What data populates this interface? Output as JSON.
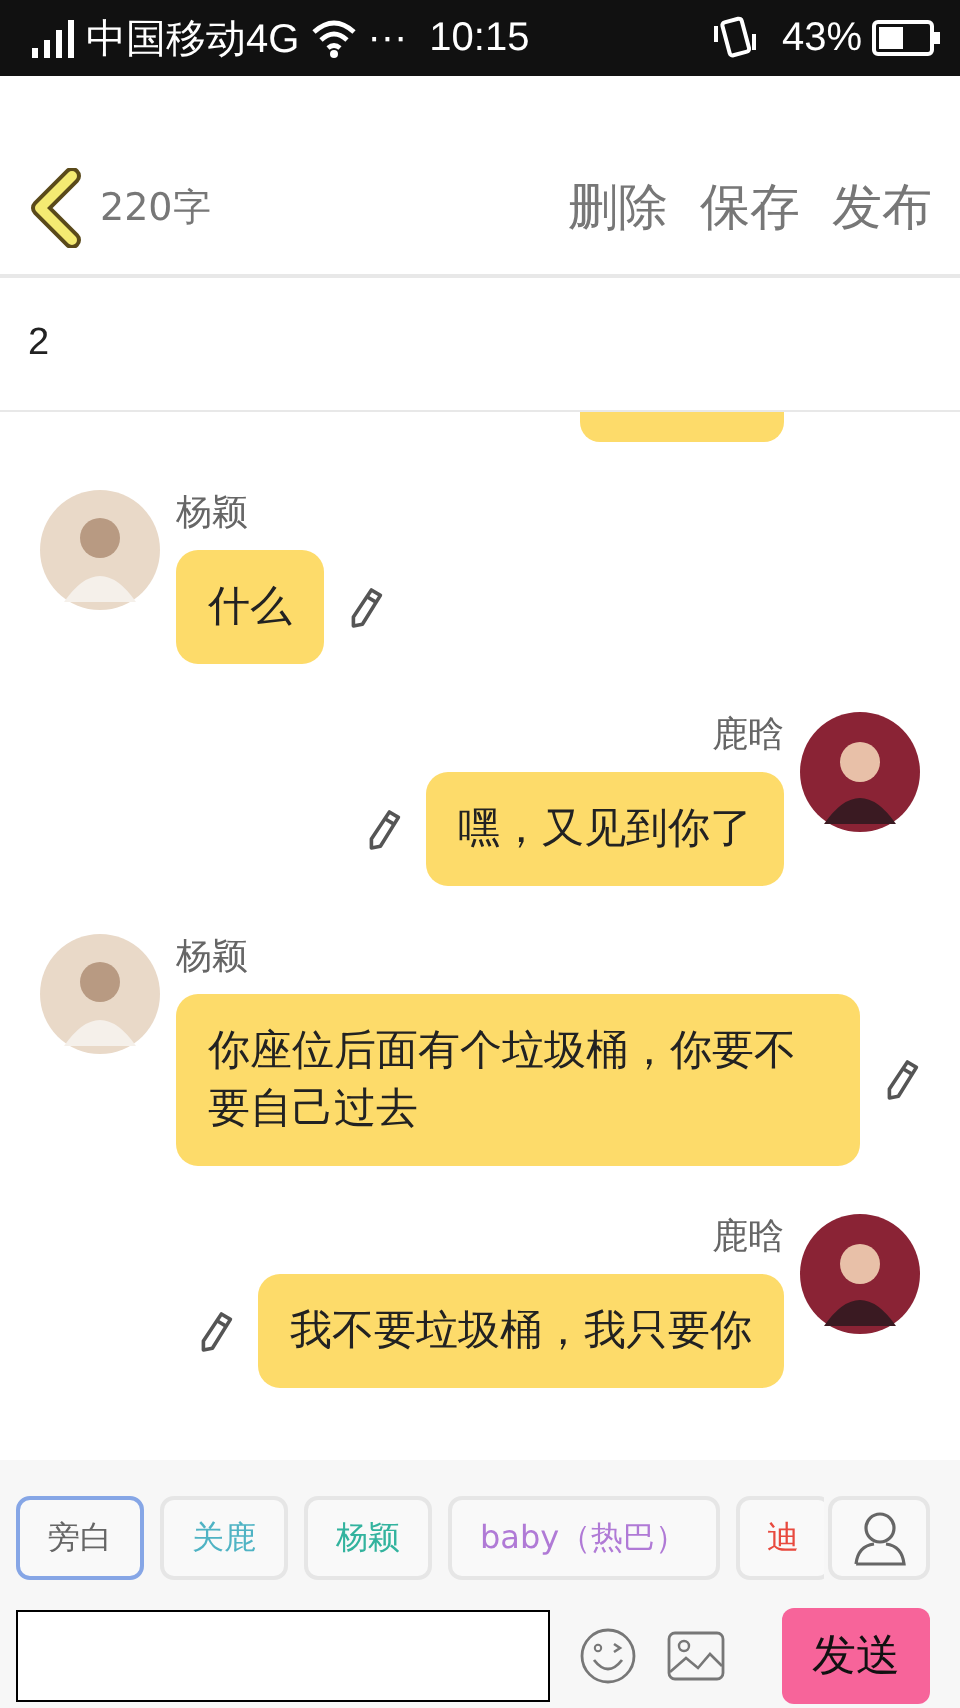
{
  "status_bar": {
    "carrier": "中国移动4G",
    "dots": "···",
    "time": "10:15",
    "battery_text": "43%"
  },
  "header": {
    "count": "220字",
    "actions": [
      "删除",
      "保存",
      "发布"
    ]
  },
  "title_field": {
    "value": "2"
  },
  "messages": [
    {
      "kind": "left",
      "name": "杨颖",
      "text": "什么"
    },
    {
      "kind": "right",
      "name": "鹿晗",
      "text": "嘿，又见到你了"
    },
    {
      "kind": "left",
      "name": "杨颖",
      "text": "你座位后面有个垃圾桶，你要不要自己过去"
    },
    {
      "kind": "right",
      "name": "鹿晗",
      "text": "我不要垃圾桶，我只要你"
    }
  ],
  "roles": [
    {
      "label": "旁白",
      "color": "#666666",
      "selected": true
    },
    {
      "label": "关鹿",
      "color": "#4fb3c4",
      "selected": false
    },
    {
      "label": "杨颖",
      "color": "#33b39e",
      "selected": false
    },
    {
      "label": "baby（热巴）",
      "color": "#b07ad6",
      "selected": false
    },
    {
      "label": "迪",
      "color": "#e8493e",
      "selected": false
    }
  ],
  "send_button": "发送"
}
